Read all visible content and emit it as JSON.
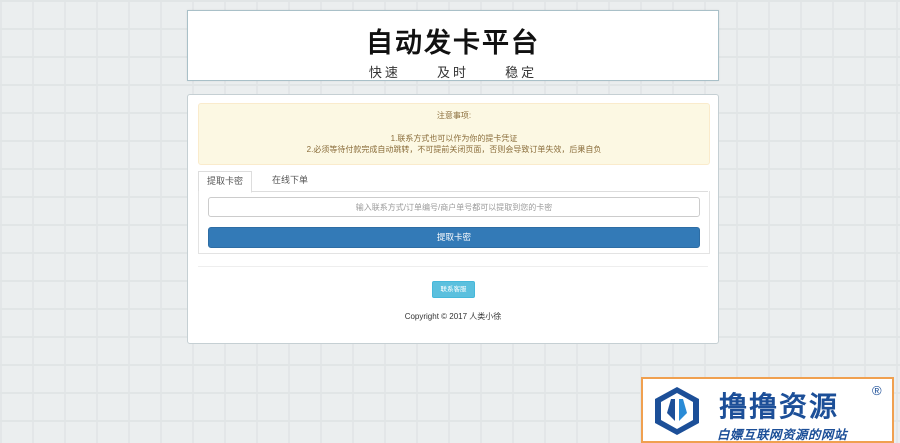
{
  "header": {
    "title": "自动发卡平台",
    "slogan": [
      "快速",
      "及时",
      "稳定"
    ]
  },
  "notice": {
    "title": "注意事项:",
    "line1": "1.联系方式也可以作为你的提卡凭证",
    "line2": "2.必须等待付款完成自动跳转，不可提前关闭页面，否则会导致订单失效，后果自负"
  },
  "tabs": [
    {
      "label": "提取卡密",
      "active": true
    },
    {
      "label": "在线下单",
      "active": false
    }
  ],
  "form": {
    "input_placeholder": "输入联系方式/订单编号/商户单号都可以提取到您的卡密",
    "input_value": "",
    "submit_label": "提取卡密"
  },
  "order_query_label": "联系客服",
  "copyright": "Copyright © 2017 人类小徐",
  "colors": {
    "primary": "#337ab7",
    "info": "#5bc0de",
    "warning_bg": "#fcf8e3",
    "warning_text": "#8a6d3b",
    "watermark_blue": "#1c4f98",
    "watermark_border": "#f0a050"
  },
  "watermark": {
    "brand": "撸撸资源",
    "registered": "®",
    "subtitle": "白嫖互联网资源的网站",
    "logo_icon": "ll-logo-icon"
  }
}
